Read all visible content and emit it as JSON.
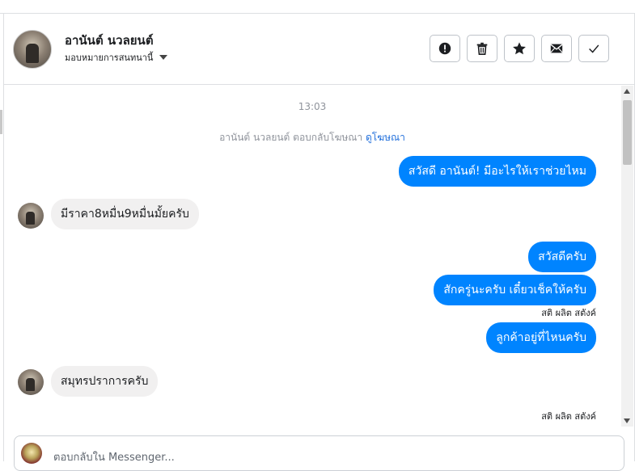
{
  "header": {
    "contact_name": "อานันต์ นวลยนต์",
    "assign_label": "มอบหมายการสนทนานี้",
    "actions": [
      {
        "icon": "alert-circle-icon",
        "name": "mark-spam-button"
      },
      {
        "icon": "trash-icon",
        "name": "delete-button"
      },
      {
        "icon": "star-icon",
        "name": "star-button"
      },
      {
        "icon": "envelope-icon",
        "name": "mark-unread-button"
      },
      {
        "icon": "checkmark-icon",
        "name": "mark-done-button"
      }
    ]
  },
  "chat": {
    "timestamp": "13:03",
    "ad_reply_text": "อานันต์ นวลยนต์ ตอบกลับโฆษณา",
    "ad_link": "ดูโฆษณา",
    "messages": [
      {
        "direction": "out",
        "text": "สวัสดี อานันต์! มีอะไรให้เราช่วยไหม"
      },
      {
        "direction": "in",
        "text": "มีราคา8หมื่น9หมื่นมั้ยครับ"
      },
      {
        "direction": "out",
        "text": "สวัสดีครับ"
      },
      {
        "direction": "out",
        "text": "สักครู่นะครับ เดี๋ยวเช็คให้ครับ"
      },
      {
        "direction": "out",
        "text": "ลูกค้าอยู่ที่ไหนครับ"
      },
      {
        "direction": "in",
        "text": "สมุทรปราการครับ"
      }
    ],
    "sender_label_1": "สติ ผลิต สตังค์",
    "sender_label_2": "สติ ผลิต สตังค์"
  },
  "composer": {
    "placeholder": "ตอบกลับใน Messenger..."
  },
  "colors": {
    "outgoing_bubble": "#0084ff",
    "incoming_bubble": "#f1f0f0",
    "link": "#216fdb"
  }
}
